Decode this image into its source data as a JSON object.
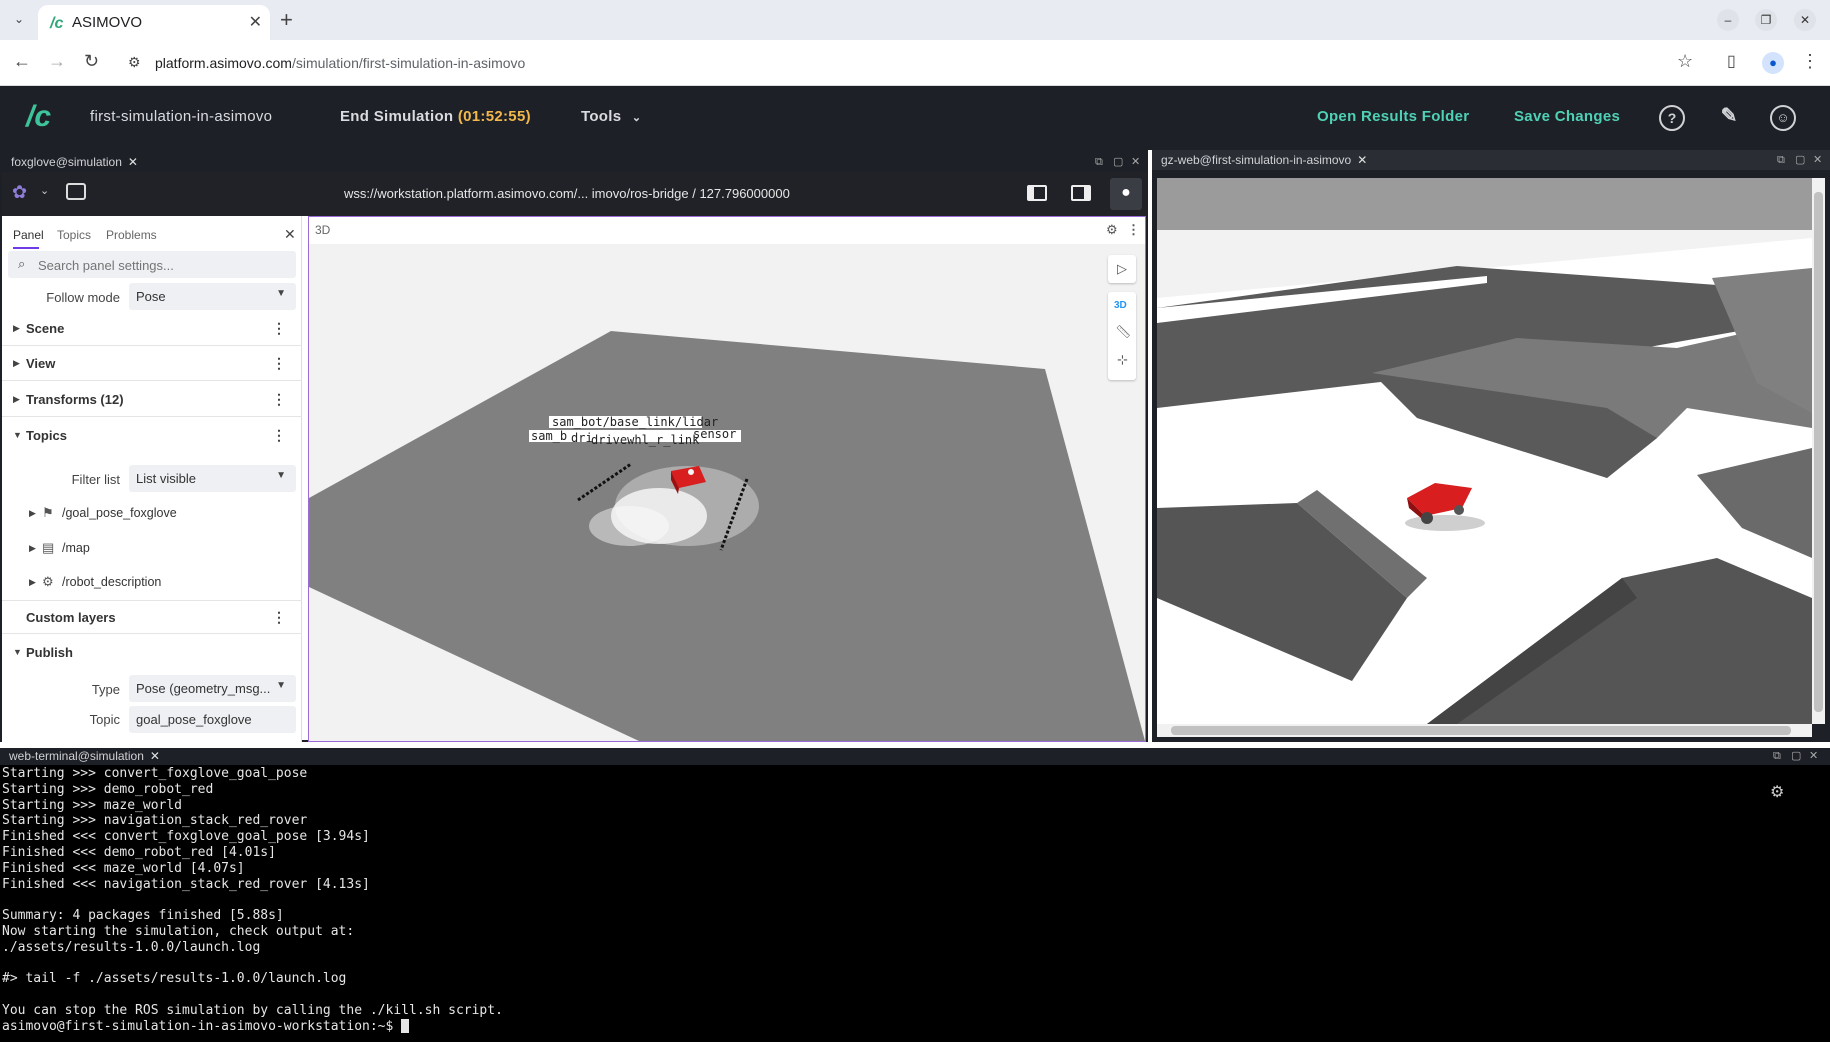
{
  "browser": {
    "tab_title": "ASIMOVO",
    "url_host": "platform.asimovo.com",
    "url_path": "/simulation/first-simulation-in-asimovo"
  },
  "app": {
    "project": "first-simulation-in-asimovo",
    "end_simulation": "End Simulation",
    "timer": "(01:52:55)",
    "tools": "Tools",
    "open_results": "Open Results Folder",
    "save_changes": "Save Changes"
  },
  "foxglove": {
    "pane_title": "foxglove@simulation",
    "connection": "wss://workstation.platform.asimovo.com/... imovo/ros-bridge / 127.796000000",
    "tabs": [
      "Panel",
      "Topics",
      "Problems"
    ],
    "search_placeholder": "Search panel settings...",
    "follow_mode_label": "Follow mode",
    "follow_mode_value": "Pose",
    "sections": {
      "scene": "Scene",
      "view": "View",
      "transforms": "Transforms (12)",
      "topics": "Topics",
      "custom_layers": "Custom layers",
      "publish": "Publish"
    },
    "filter_label": "Filter list",
    "filter_value": "List visible",
    "topic_items": [
      "/goal_pose_foxglove",
      "/map",
      "/robot_description"
    ],
    "publish_type_label": "Type",
    "publish_type_value": "Pose (geometry_msg...",
    "publish_topic_label": "Topic",
    "publish_topic_value": "goal_pose_foxglove",
    "viewport_title": "3D",
    "viewport_3d_btn": "3D",
    "frame_labels": [
      "sam_bot/base_link/lidar",
      "sam_b",
      "dri",
      "drivewhl_r_link",
      "sensor"
    ]
  },
  "gazebo": {
    "pane_title": "gz-web@first-simulation-in-asimovo"
  },
  "terminal": {
    "pane_title": "web-terminal@simulation",
    "lines": [
      "Starting >>> convert_foxglove_goal_pose",
      "Starting >>> demo_robot_red",
      "Starting >>> maze_world",
      "Starting >>> navigation_stack_red_rover",
      "Finished <<< convert_foxglove_goal_pose [3.94s]",
      "Finished <<< demo_robot_red [4.01s]",
      "Finished <<< maze_world [4.07s]",
      "Finished <<< navigation_stack_red_rover [4.13s]",
      "",
      "Summary: 4 packages finished [5.88s]",
      "Now starting the simulation, check output at:",
      "./assets/results-1.0.0/launch.log",
      "",
      "#> tail -f ./assets/results-1.0.0/launch.log",
      "",
      "You can stop the ROS simulation by calling the ./kill.sh script.",
      "asimovo@first-simulation-in-asimovo-workstation:~$ "
    ]
  },
  "colors": {
    "app_bar": "#1d2026",
    "accent": "#4fd1b5",
    "timer": "#f2b84b",
    "robot": "#d81e1e"
  }
}
